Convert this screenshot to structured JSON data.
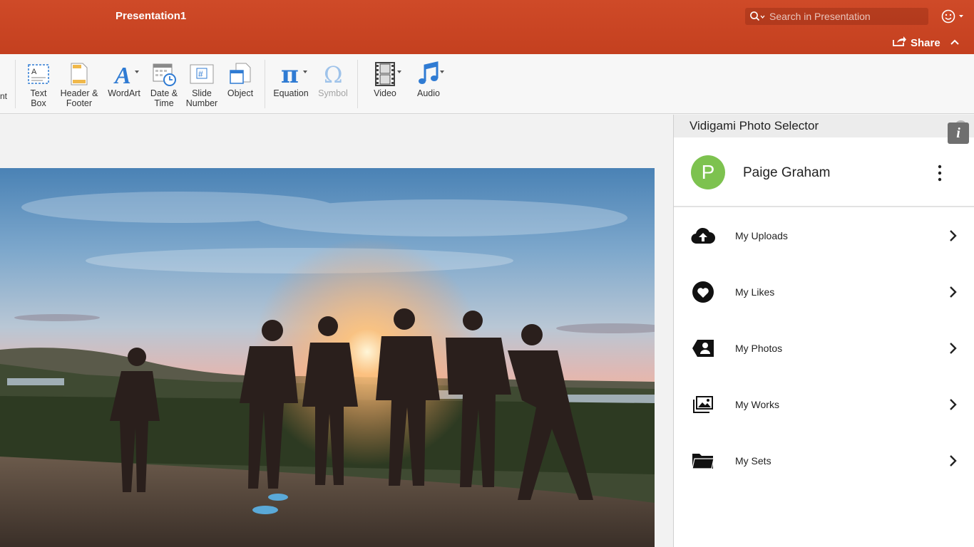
{
  "window": {
    "title": "Presentation1"
  },
  "search": {
    "placeholder": "Search in Presentation"
  },
  "share": {
    "label": "Share"
  },
  "ribbon": {
    "cut_label": "nt",
    "buttons": [
      {
        "label": "Text\nBox"
      },
      {
        "label": "Header &\nFooter"
      },
      {
        "label": "WordArt"
      },
      {
        "label": "Date &\nTime"
      },
      {
        "label": "Slide\nNumber"
      },
      {
        "label": "Object"
      },
      {
        "label": "Equation"
      },
      {
        "label": "Symbol"
      },
      {
        "label": "Video"
      },
      {
        "label": "Audio"
      }
    ]
  },
  "pane": {
    "title": "Vidigami Photo Selector",
    "user": {
      "initial": "P",
      "name": "Paige Graham"
    },
    "info_label": "i",
    "menu": [
      {
        "label": "My Uploads",
        "icon": "cloud-upload-icon"
      },
      {
        "label": "My Likes",
        "icon": "heart-icon"
      },
      {
        "label": "My Photos",
        "icon": "person-tag-icon"
      },
      {
        "label": "My Works",
        "icon": "photo-stack-icon"
      },
      {
        "label": "My Sets",
        "icon": "folder-icon"
      }
    ]
  },
  "colors": {
    "titlebar": "#c8442a",
    "avatar": "#7dc24f",
    "ribbon_icon_blue": "#2f7bd3"
  }
}
